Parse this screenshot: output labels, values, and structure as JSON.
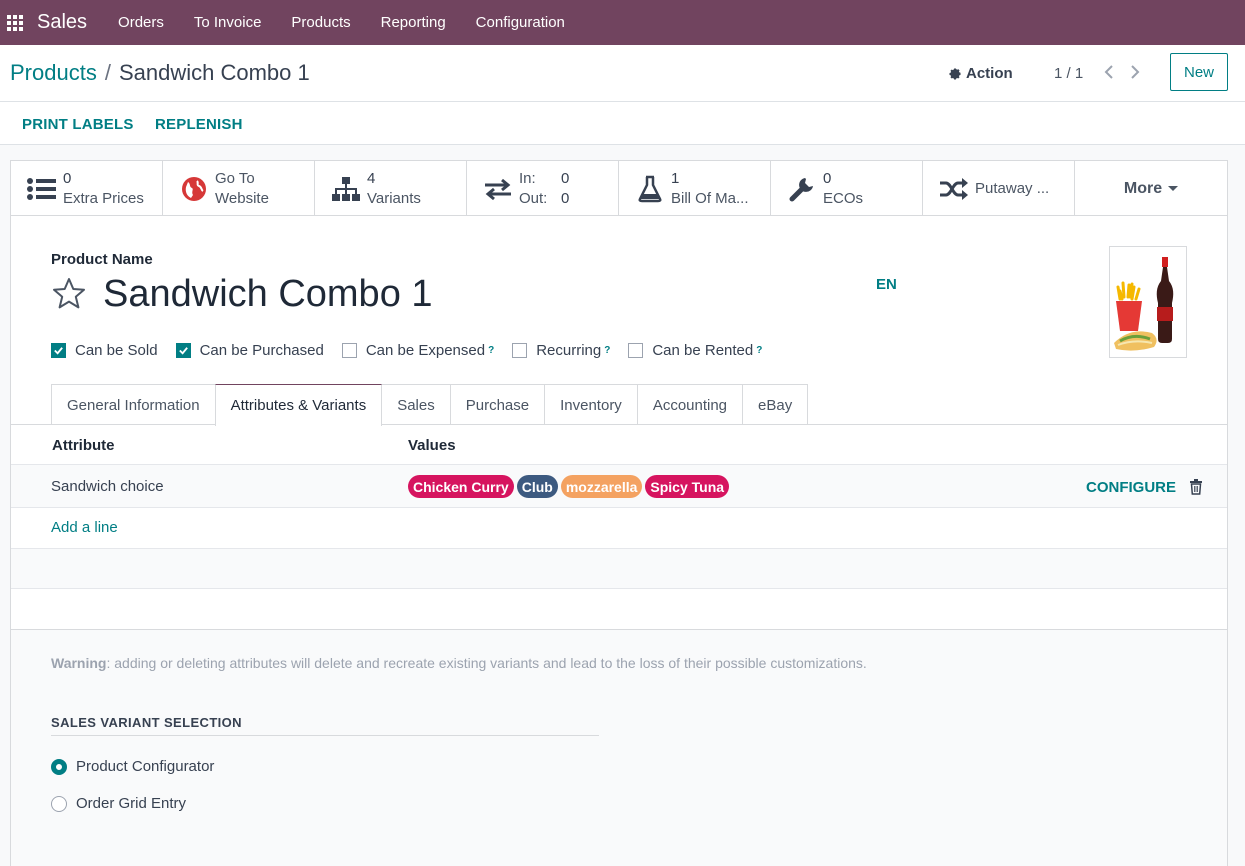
{
  "nav": {
    "app_name": "Sales",
    "menu": [
      "Orders",
      "To Invoice",
      "Products",
      "Reporting",
      "Configuration"
    ]
  },
  "control_panel": {
    "breadcrumb_parent": "Products",
    "breadcrumb_separator": "/",
    "breadcrumb_current": "Sandwich Combo 1",
    "action_label": "Action",
    "pager": "1 / 1",
    "new_label": "New"
  },
  "statusbar": {
    "print_labels": "PRINT LABELS",
    "replenish": "REPLENISH"
  },
  "smart_buttons": {
    "extra_prices": {
      "value": "0",
      "label": "Extra Prices",
      "icon": "list-icon"
    },
    "website": {
      "line1": "Go To",
      "line2": "Website",
      "icon": "globe-icon"
    },
    "variants": {
      "value": "4",
      "label": "Variants",
      "icon": "sitemap-icon"
    },
    "in_out": {
      "in_label": "In:",
      "in_value": "0",
      "out_label": "Out:",
      "out_value": "0",
      "icon": "exchange-icon"
    },
    "bom": {
      "value": "1",
      "label": "Bill Of Ma...",
      "icon": "flask-icon"
    },
    "ecos": {
      "value": "0",
      "label": "ECOs",
      "icon": "wrench-icon"
    },
    "putaway": {
      "label": "Putaway ...",
      "icon": "random-icon"
    },
    "more": {
      "label": "More"
    }
  },
  "product": {
    "name_label": "Product Name",
    "name": "Sandwich Combo 1",
    "lang": "EN",
    "options": {
      "can_be_sold": "Can be Sold",
      "can_be_purchased": "Can be Purchased",
      "can_be_expensed": "Can be Expensed",
      "recurring": "Recurring",
      "can_be_rented": "Can be Rented",
      "help_mark": "?"
    }
  },
  "tabs": [
    "General Information",
    "Attributes & Variants",
    "Sales",
    "Purchase",
    "Inventory",
    "Accounting",
    "eBay"
  ],
  "attributes_table": {
    "headers": {
      "attribute": "Attribute",
      "values": "Values"
    },
    "rows": [
      {
        "attribute": "Sandwich choice",
        "values": [
          {
            "label": "Chicken Curry",
            "color": "#d6145f"
          },
          {
            "label": "Club",
            "color": "#3d5a80"
          },
          {
            "label": "mozzarella",
            "color": "#f4a261"
          },
          {
            "label": "Spicy Tuna",
            "color": "#d6145f"
          }
        ],
        "configure": "CONFIGURE"
      }
    ],
    "add_line": "Add a line"
  },
  "warning": {
    "bold": "Warning",
    "text": ": adding or deleting attributes will delete and recreate existing variants and lead to the loss of their possible customizations."
  },
  "sales_variant": {
    "title": "SALES VARIANT SELECTION",
    "options": [
      "Product Configurator",
      "Order Grid Entry"
    ]
  },
  "colors": {
    "navbar": "#71445f",
    "accent": "#017e84"
  }
}
